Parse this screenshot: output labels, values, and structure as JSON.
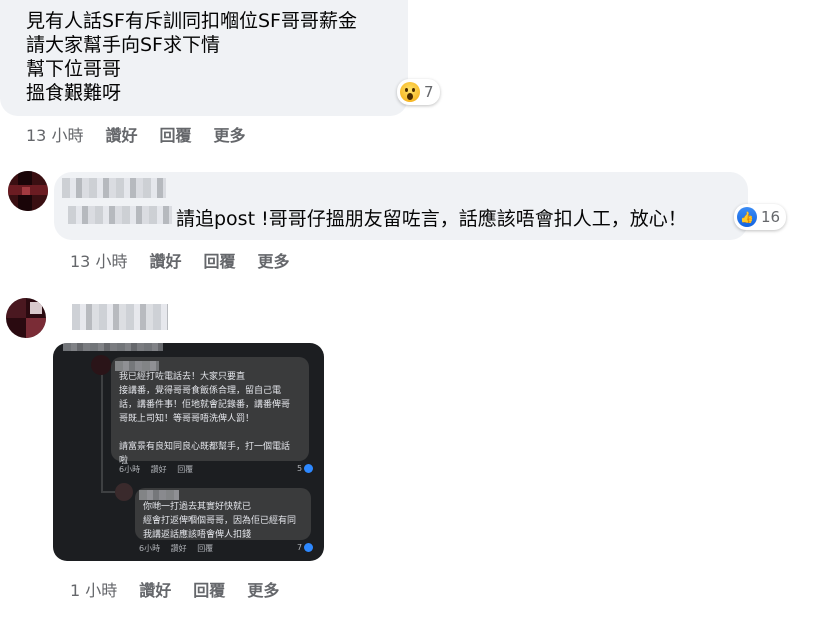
{
  "comment1": {
    "lines": [
      "見有人話SF有斥訓同扣嗰位SF哥哥薪金",
      "請大家幫手向SF求下情",
      "幫下位哥哥",
      "搵食艱難呀"
    ],
    "reaction_count": "7",
    "reaction_icon": "wow-emoji-icon",
    "time": "13 小時",
    "like": "讚好",
    "reply": "回覆",
    "more": "更多"
  },
  "comment2": {
    "text": "請追post !哥哥仔搵朋友留咗言，話應該唔會扣人工，放心！",
    "reaction_count": "16",
    "reaction_icon": "like-icon",
    "time": "13 小時",
    "like": "讚好",
    "reply": "回覆",
    "more": "更多"
  },
  "comment3": {
    "screenshot": {
      "reply1_text": "我已經打咗電話去！大家只要直\n接講番，覺得哥哥食飯係合理，留自己電\n話，講番件事！佢地就會記錄番，講番俾哥\n哥既上司知！等哥哥唔洗俾人罰！\n\n請富景有良知同良心既都幫手，打一個電話\n啦",
      "reply1_time": "6小時",
      "reply1_like": "讚好",
      "reply1_reply": "回覆",
      "reply1_count": "5",
      "reply2_text": "你哋一打過去其實好快就已\n經會打返俾嗰個哥哥，因為佢已經有同\n我講返話應該唔會俾人扣錢",
      "reply2_time": "6小時",
      "reply2_like": "讚好",
      "reply2_reply": "回覆",
      "reply2_count": "7"
    },
    "time": "1 小時",
    "like": "讚好",
    "reply": "回覆",
    "more": "更多"
  },
  "colors": {
    "bubble": "#f0f2f5",
    "meta_text": "#65676b",
    "like_blue": "#1877f2",
    "dark_bg": "#1c1e21"
  }
}
